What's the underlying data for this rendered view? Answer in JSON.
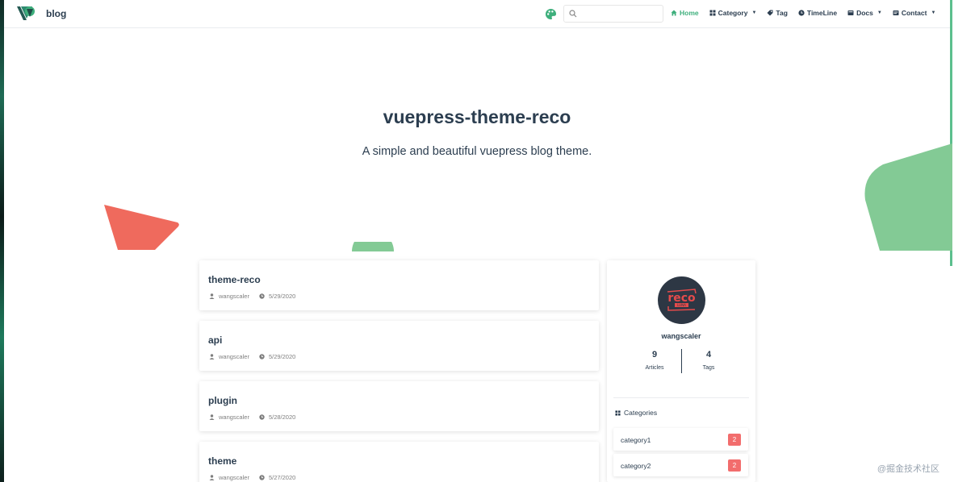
{
  "navbar": {
    "site_name": "blog",
    "search_placeholder": "",
    "items": [
      {
        "label": "Home",
        "icon": "home-icon",
        "active": true
      },
      {
        "label": "Category",
        "icon": "category-icon",
        "dropdown": true
      },
      {
        "label": "Tag",
        "icon": "tag-icon"
      },
      {
        "label": "TimeLine",
        "icon": "clock-icon"
      },
      {
        "label": "Docs",
        "icon": "docs-icon",
        "dropdown": true
      },
      {
        "label": "Contact",
        "icon": "contact-icon",
        "dropdown": true
      }
    ]
  },
  "hero": {
    "title": "vuepress-theme-reco",
    "description": "A simple and beautiful vuepress blog theme."
  },
  "articles": [
    {
      "title": "theme-reco",
      "author": "wangscaler",
      "date": "5/29/2020"
    },
    {
      "title": "api",
      "author": "wangscaler",
      "date": "5/29/2020"
    },
    {
      "title": "plugin",
      "author": "wangscaler",
      "date": "5/28/2020"
    },
    {
      "title": "theme",
      "author": "wangscaler",
      "date": "5/27/2020"
    }
  ],
  "sidebar": {
    "avatar_text": "reco",
    "avatar_subtext": "LUNA",
    "author": "wangscaler",
    "stats": [
      {
        "value": "9",
        "label": "Articles"
      },
      {
        "value": "4",
        "label": "Tags"
      }
    ],
    "categories_heading": "Categories",
    "categories": [
      {
        "name": "category1",
        "count": "2"
      },
      {
        "name": "category2",
        "count": "2"
      }
    ]
  },
  "watermark": "@掘金技术社区",
  "colors": {
    "accent": "#3eaf7c",
    "badge": "#f26d6d",
    "deco_red": "#ef6a5d",
    "deco_green": "#83ca95"
  }
}
